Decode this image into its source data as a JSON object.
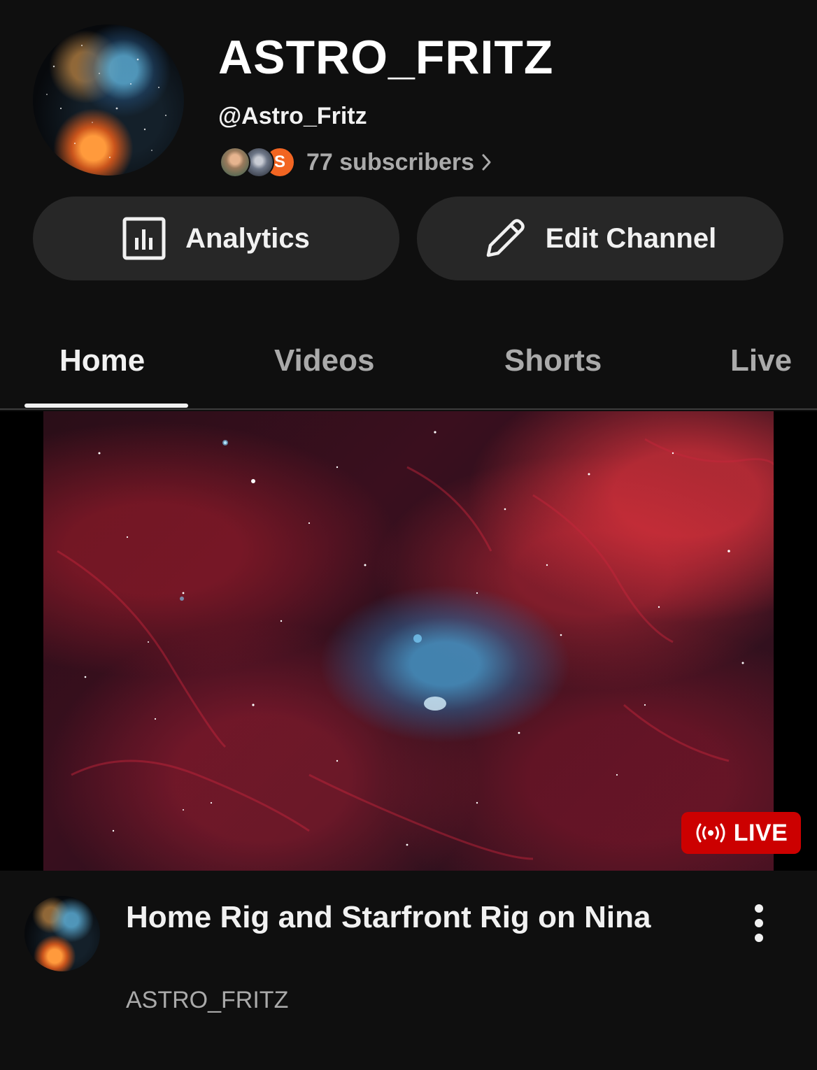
{
  "channel": {
    "title": "ASTRO_FRITZ",
    "handle": "@Astro_Fritz",
    "subscriber_avatar_letter": "S",
    "subscribers_label": "77 subscribers",
    "avatar_icon": "channel-avatar-nebula"
  },
  "actions": {
    "analytics_label": "Analytics",
    "analytics_icon": "bar-chart-icon",
    "edit_label": "Edit Channel",
    "edit_icon": "pencil-icon"
  },
  "tabs": [
    {
      "label": "Home",
      "active": true
    },
    {
      "label": "Videos",
      "active": false
    },
    {
      "label": "Shorts",
      "active": false
    },
    {
      "label": "Live",
      "active": false
    }
  ],
  "video": {
    "badge": "LIVE",
    "badge_icon": "broadcast-icon",
    "title": "Home Rig and Starfront Rig on Nina",
    "channel": "ASTRO_FRITZ",
    "menu_icon": "more-vertical-icon"
  },
  "colors": {
    "background": "#0f0f0f",
    "button_bg": "#272727",
    "live_red": "#cc0000",
    "subscriber_orange": "#f26522",
    "secondary_text": "#aaaaaa"
  }
}
